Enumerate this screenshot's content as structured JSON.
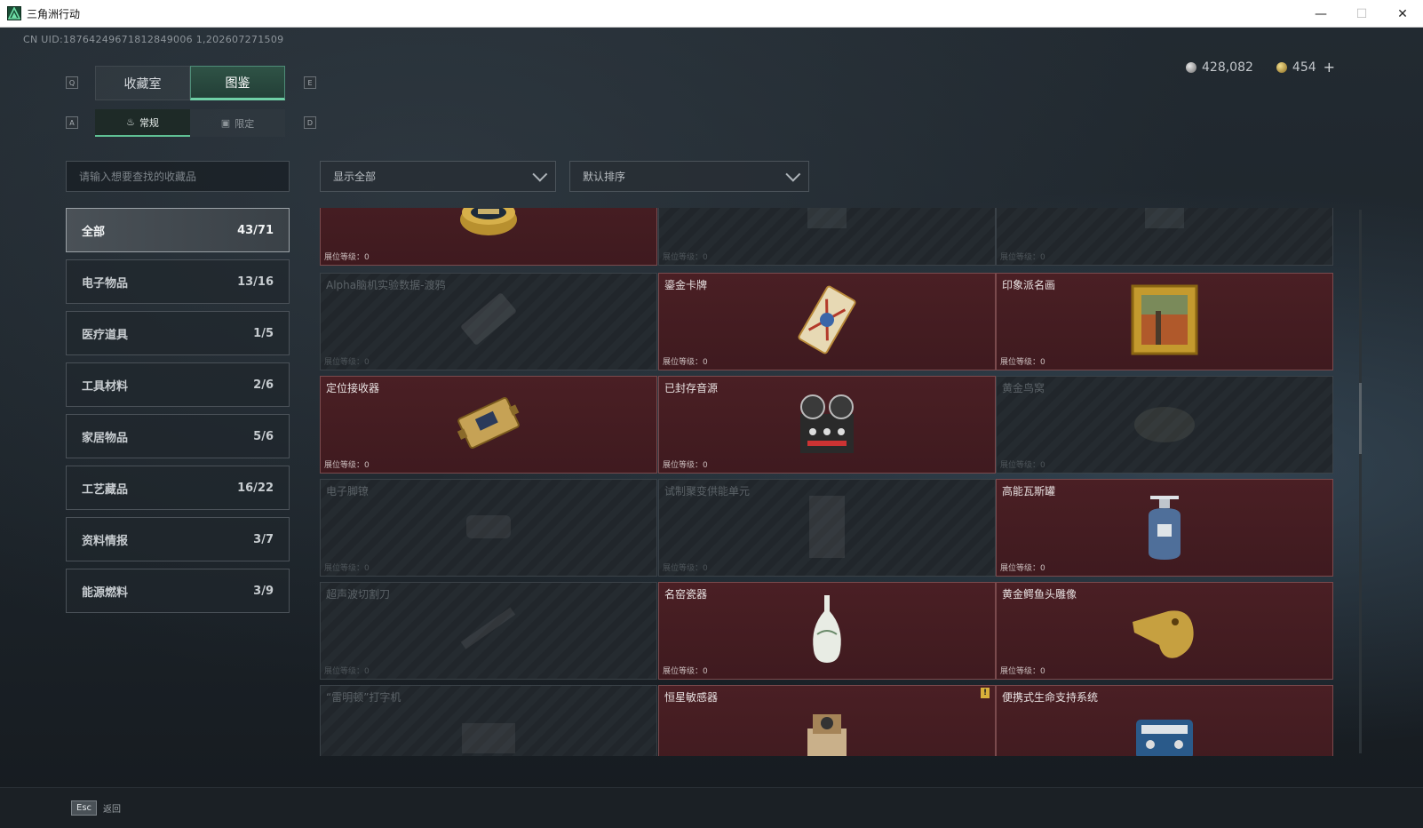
{
  "window": {
    "title": "三角洲行动",
    "min": "—",
    "max": "☐",
    "close": "✕"
  },
  "uid": "CN UID:18764249671812849006 1,202607271509",
  "currency": {
    "silver": "428,082",
    "gold": "454",
    "plus": "+"
  },
  "keys": {
    "q": "Q",
    "e": "E",
    "a": "A",
    "d": "D"
  },
  "tabs": [
    {
      "label": "收藏室"
    },
    {
      "label": "图鉴"
    }
  ],
  "subtabs": [
    {
      "label": "常规"
    },
    {
      "label": "限定"
    }
  ],
  "search": {
    "placeholder": "请输入想要查找的收藏品"
  },
  "filter": {
    "show": "显示全部",
    "sort": "默认排序"
  },
  "categories": [
    {
      "label": "全部",
      "count": "43/71"
    },
    {
      "label": "电子物品",
      "count": "13/16"
    },
    {
      "label": "医疗道具",
      "count": "1/5"
    },
    {
      "label": "工具材料",
      "count": "2/6"
    },
    {
      "label": "家居物品",
      "count": "5/6"
    },
    {
      "label": "工艺藏品",
      "count": "16/22"
    },
    {
      "label": "资料情报",
      "count": "3/7"
    },
    {
      "label": "能源燃料",
      "count": "3/9"
    }
  ],
  "level_label": "展位等级：0",
  "items": [
    {
      "name": "",
      "owned": true,
      "icon": "caviar-tin-icon"
    },
    {
      "name": "",
      "owned": false,
      "icon": "item-icon"
    },
    {
      "name": "",
      "owned": false,
      "icon": "item-icon"
    },
    {
      "name": "Alpha脑机实验数据-渡鸦",
      "owned": false,
      "icon": "data-drive-icon"
    },
    {
      "name": "鎏金卡牌",
      "owned": true,
      "icon": "gilded-card-icon"
    },
    {
      "name": "印象派名画",
      "owned": true,
      "icon": "painting-icon"
    },
    {
      "name": "定位接收器",
      "owned": true,
      "icon": "gps-receiver-icon"
    },
    {
      "name": "已封存音源",
      "owned": true,
      "icon": "reel-recorder-icon"
    },
    {
      "name": "黄金鸟窝",
      "owned": false,
      "icon": "bird-nest-icon"
    },
    {
      "name": "电子脚镣",
      "owned": false,
      "icon": "ankle-monitor-icon"
    },
    {
      "name": "试制聚变供能单元",
      "owned": false,
      "icon": "fusion-cell-icon"
    },
    {
      "name": "高能瓦斯罐",
      "owned": true,
      "icon": "gas-canister-icon"
    },
    {
      "name": "超声波切割刀",
      "owned": false,
      "icon": "ultrasonic-cutter-icon"
    },
    {
      "name": "名窑瓷器",
      "owned": true,
      "icon": "porcelain-vase-icon"
    },
    {
      "name": "黄金鳄鱼头雕像",
      "owned": true,
      "icon": "golden-croc-icon"
    },
    {
      "name": "“雷明顿”打字机",
      "owned": false,
      "icon": "typewriter-icon"
    },
    {
      "name": "恒星敏感器",
      "owned": true,
      "icon": "star-sensor-icon",
      "warn": "!"
    },
    {
      "name": "便携式生命支持系统",
      "owned": true,
      "icon": "life-support-icon"
    }
  ],
  "bottom": {
    "esc": "Esc",
    "back": "返回"
  },
  "colors": {
    "owned_bg": "#3f1a1f",
    "accent": "#6fd0a6",
    "active_tab": "#2f5346"
  }
}
